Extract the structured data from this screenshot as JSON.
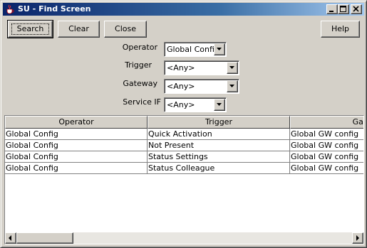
{
  "window": {
    "title": "SU - Find Screen"
  },
  "toolbar": {
    "search_label": "Search",
    "clear_label": "Clear",
    "close_label": "Close",
    "help_label": "Help"
  },
  "filters": {
    "operator": {
      "label": "Operator",
      "value": "Global Config"
    },
    "trigger": {
      "label": "Trigger",
      "value": "<Any>"
    },
    "gateway": {
      "label": "Gateway",
      "value": "<Any>"
    },
    "service_if": {
      "label": "Service IF",
      "value": "<Any>"
    }
  },
  "table": {
    "columns": [
      "Operator",
      "Trigger",
      "Gate"
    ],
    "rows": [
      [
        "Global Config",
        "Quick Activation",
        "Global GW config"
      ],
      [
        "Global Config",
        "Not Present",
        "Global GW config"
      ],
      [
        "Global Config",
        "Status Settings",
        "Global GW config"
      ],
      [
        "Global Config",
        "Status Colleague",
        "Global GW config"
      ]
    ]
  },
  "colors": {
    "titlebar_start": "#0a246a",
    "titlebar_end": "#a6caf0",
    "face": "#d4d0c8"
  }
}
